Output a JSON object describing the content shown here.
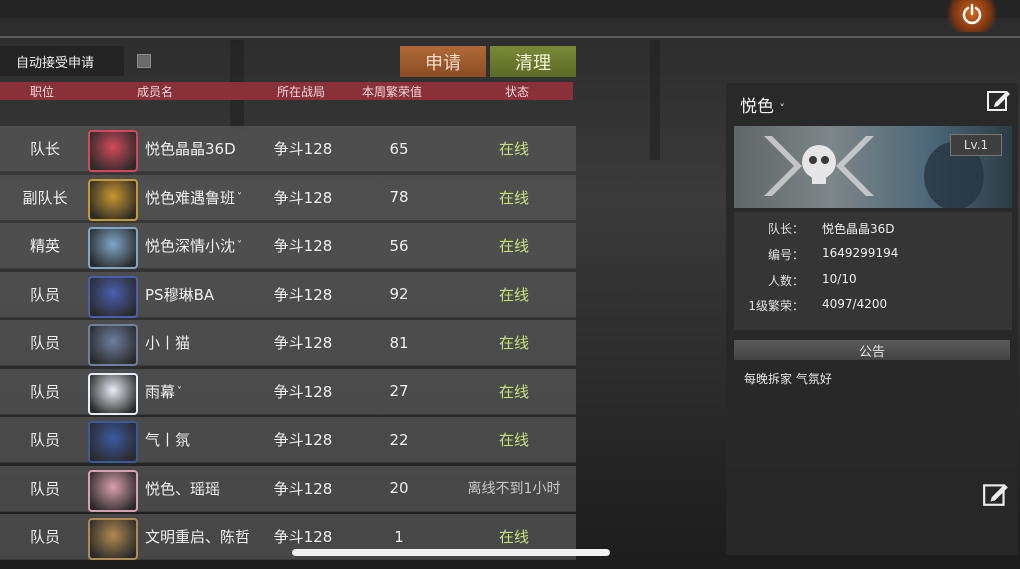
{
  "top": {
    "auto_accept_label": "自动接受申请",
    "apply_label": "申请",
    "clear_label": "清理"
  },
  "columns": {
    "position": "职位",
    "member": "成员名",
    "zone": "所在战局",
    "prosperity": "本周繁荣值",
    "status": "状态"
  },
  "members": [
    {
      "position": "队长",
      "name": "悦色晶晶36D",
      "caret": "",
      "zone": "争斗128",
      "prosperity": "65",
      "status": "在线",
      "online": true,
      "avatar_color": "#d24a5a"
    },
    {
      "position": "副队长",
      "name": "悦色难遇鲁班",
      "caret": "˅",
      "zone": "争斗128",
      "prosperity": "78",
      "status": "在线",
      "online": true,
      "avatar_color": "#c9982e"
    },
    {
      "position": "精英",
      "name": "悦色深情小沈",
      "caret": "˅",
      "zone": "争斗128",
      "prosperity": "56",
      "status": "在线",
      "online": true,
      "avatar_color": "#7fa8c8"
    },
    {
      "position": "队员",
      "name": "PS穆琳BA",
      "caret": "",
      "zone": "争斗128",
      "prosperity": "92",
      "status": "在线",
      "online": true,
      "avatar_color": "#4a5fb0"
    },
    {
      "position": "队员",
      "name": "小丨猫",
      "caret": "",
      "zone": "争斗128",
      "prosperity": "81",
      "status": "在线",
      "online": true,
      "avatar_color": "#6e7fa0"
    },
    {
      "position": "队员",
      "name": "雨幕",
      "caret": "˅",
      "zone": "争斗128",
      "prosperity": "27",
      "status": "在线",
      "online": true,
      "avatar_color": "#e8eef5"
    },
    {
      "position": "队员",
      "name": "气丨氛",
      "caret": "",
      "zone": "争斗128",
      "prosperity": "22",
      "status": "在线",
      "online": true,
      "avatar_color": "#3a5aa0"
    },
    {
      "position": "队员",
      "name": "悦色、瑶瑶",
      "caret": "",
      "zone": "争斗128",
      "prosperity": "20",
      "status": "离线不到1小时",
      "online": false,
      "avatar_color": "#d8a0b0"
    },
    {
      "position": "队员",
      "name": "文明重启、陈哲",
      "caret": "",
      "zone": "争斗128",
      "prosperity": "1",
      "status": "在线",
      "online": true,
      "avatar_color": "#b08a50"
    }
  ],
  "guild": {
    "name": "悦色",
    "level": "Lv.1",
    "info": [
      {
        "label": "队长：",
        "value": "悦色晶晶36D"
      },
      {
        "label": "编号：",
        "value": "1649299194"
      },
      {
        "label": "人数：",
        "value": "10/10"
      },
      {
        "label": "1级繁荣：",
        "value": "4097/4200"
      }
    ],
    "notice_title": "公告",
    "notice_text": "每晚拆家 气氛好"
  },
  "colors": {
    "online": "#c8e07a",
    "header_bar": "#8a3038",
    "apply_btn": "#8a4c24",
    "clear_btn": "#5c6b26"
  },
  "icons": [
    "power-icon",
    "edit-icon",
    "chevron-down-icon",
    "skull-emblem-icon"
  ]
}
